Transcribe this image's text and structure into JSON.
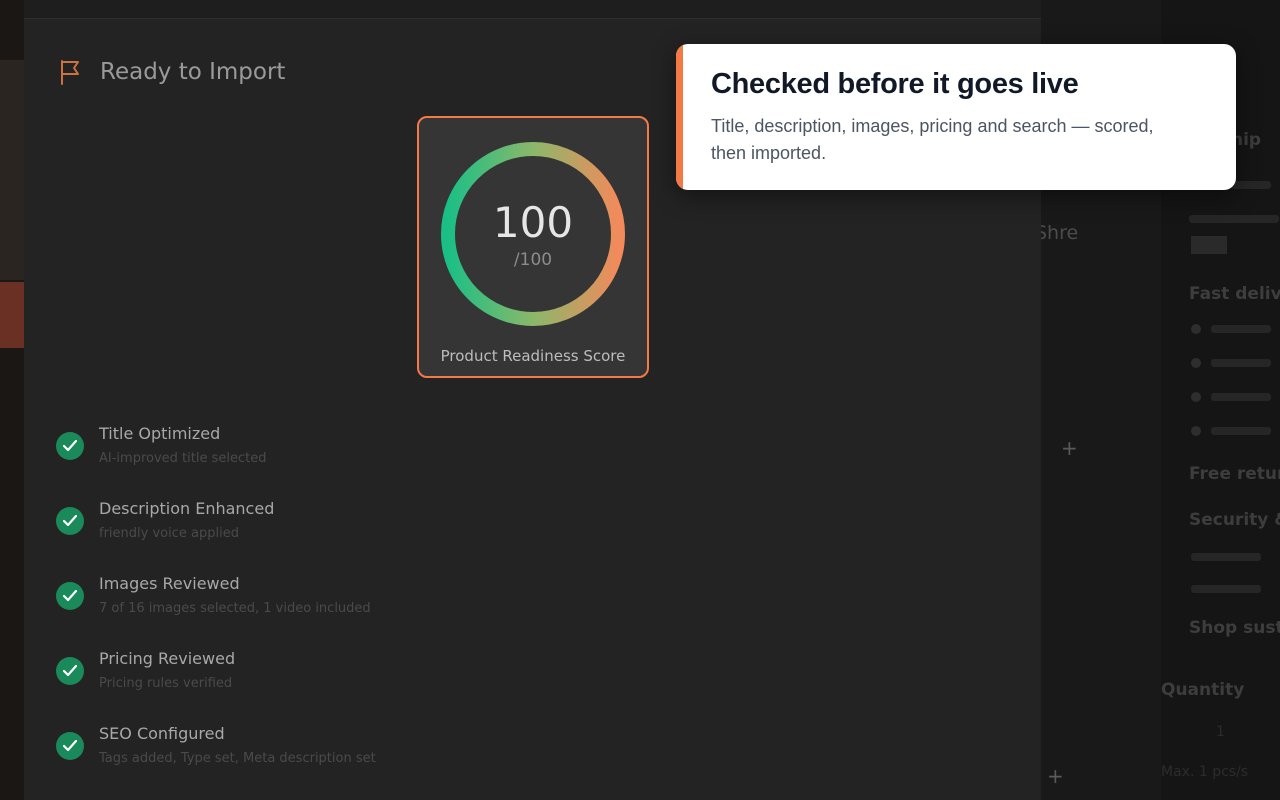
{
  "modal": {
    "title": "Ready to Import",
    "header_icon": "flag-icon",
    "score": {
      "value": "100",
      "max": "/100",
      "label": "Product Readiness Score",
      "fraction": 1.0,
      "gradient_colors": [
        "#1bbf86",
        "#8ab86a",
        "#f28a5b"
      ]
    },
    "checklist": [
      {
        "title": "Title Optimized",
        "subtitle": "AI-improved title selected",
        "status": "complete"
      },
      {
        "title": "Description Enhanced",
        "subtitle": "friendly voice applied",
        "status": "complete"
      },
      {
        "title": "Images Reviewed",
        "subtitle": "7 of 16 images selected, 1 video included",
        "status": "complete"
      },
      {
        "title": "Pricing Reviewed",
        "subtitle": "Pricing rules verified",
        "status": "complete"
      },
      {
        "title": "SEO Configured",
        "subtitle": "Tags added, Type set, Meta description set",
        "status": "complete"
      }
    ]
  },
  "callout": {
    "heading": "Checked before it goes live",
    "body": "Title, description, images, pricing and search — scored, then imported."
  },
  "background_page": {
    "partial_text": "Shre",
    "right_panel": {
      "items": [
        "hip",
        "Fast deliv",
        "Free retur",
        "Security &",
        "Shop sust"
      ],
      "quantity_label": "Quantity",
      "quantity_value": "1",
      "max_note": "Max. 1 pcs/s"
    }
  },
  "colors": {
    "accent": "#f47a45",
    "check_green": "#1b8a5a",
    "modal_bg": "#232323"
  }
}
